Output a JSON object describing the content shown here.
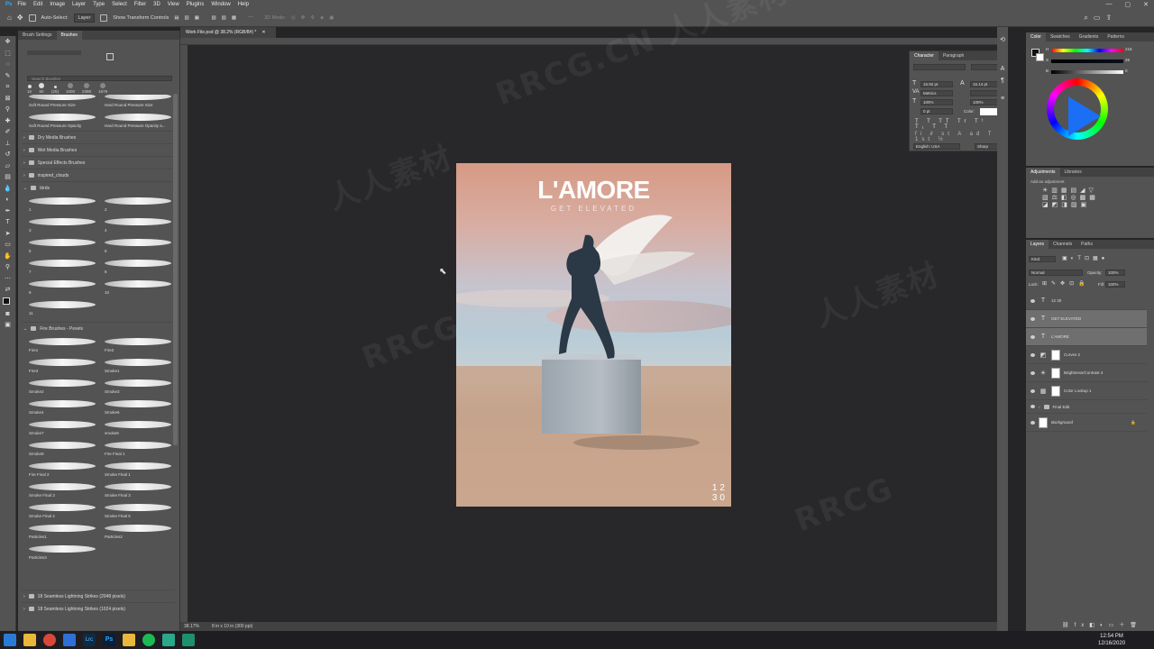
{
  "menu": {
    "items": [
      "File",
      "Edit",
      "Image",
      "Layer",
      "Type",
      "Select",
      "Filter",
      "3D",
      "View",
      "Plugins",
      "Window",
      "Help"
    ]
  },
  "options_bar": {
    "auto_select_label": "Auto-Select:",
    "auto_select_value": "Layer",
    "transform_label": "Show Transform Controls",
    "mode_label": "3D Mode:"
  },
  "brush_panel": {
    "tabs": [
      "Brush Settings",
      "Brushes"
    ],
    "search_placeholder": "Search Brushes",
    "preset_sizes": [
      "15",
      "60",
      "(25)",
      "1000",
      "2398",
      "1679"
    ],
    "top_brushes": [
      "Soft Round Pressure Size",
      "Hard Round Pressure Size",
      "Soft Round Pressure Opacity",
      "Hard Round Pressure Opacity a..."
    ],
    "folders_a": [
      "Dry Media Brushes",
      "Wet Media Brushes",
      "Special Effects Brushes",
      "inspired_clouds",
      "birds"
    ],
    "birds_brushes": [
      "1",
      "2",
      "3",
      "4",
      "5",
      "6",
      "7",
      "8",
      "9",
      "10",
      "11"
    ],
    "fire_folder": "Fire Brushes - Pexels",
    "fire_brushes": [
      "Fire1",
      "Fire2",
      "Fire3",
      "Smoke1",
      "Smoke2",
      "Smoke3",
      "Smoke4",
      "Smoke6",
      "Smoke7",
      "smoke8",
      "Smoke9",
      "Fire Final 1",
      "Fire Final 2",
      "Smoke Final 1",
      "Smoke Final 3",
      "Smoke Final 3",
      "Smoke Final 4",
      "Smoke Final 5",
      "Particles1",
      "Particles2",
      "Particles3"
    ],
    "bottom_folders": [
      "18 Seamless Lightning Strikes (2048 pixels)",
      "18 Seamless Lightning Strikes (1024 pixels)"
    ]
  },
  "document": {
    "tab_title": "Work File.psd @ 38.2% (RGB/8#) *",
    "zoom": "38.17%",
    "doc_size": "8 in x 10 in (300 ppi)"
  },
  "poster": {
    "title": "L'AMORE",
    "subtitle": "GET ELEVATED",
    "number_top": "12",
    "number_bottom": "30"
  },
  "character_panel": {
    "tabs": [
      "Character",
      "Paragraph"
    ],
    "font_size": "16.92 pt",
    "leading": "16.14 pt",
    "kerning": "Metrics",
    "vertical_scale": "100%",
    "horizontal_scale": "100%",
    "baseline": "0 pt",
    "color_label": "Color:",
    "language": "English: USA",
    "antialias": "Sharp"
  },
  "color_panel": {
    "tabs": [
      "Color",
      "Swatches",
      "Gradients",
      "Patterns"
    ],
    "h_value": "218",
    "s_value": "25",
    "b_value": "0"
  },
  "adjustments_panel": {
    "tabs": [
      "Adjustments",
      "Libraries"
    ],
    "add_label": "Add an adjustment"
  },
  "layers_panel": {
    "tabs": [
      "Layers",
      "Channels",
      "Paths"
    ],
    "kind_label": "Kind",
    "blend_mode": "Normal",
    "opacity_label": "Opacity:",
    "opacity_value": "100%",
    "lock_label": "Lock:",
    "fill_label": "Fill:",
    "fill_value": "100%",
    "layers": [
      {
        "name": "12 30",
        "type": "text",
        "selected": false
      },
      {
        "name": "GET ELEVATED",
        "type": "text",
        "selected": true
      },
      {
        "name": "L'AMORE",
        "type": "text",
        "selected": true
      },
      {
        "name": "Curves 2",
        "type": "adj",
        "selected": false
      },
      {
        "name": "Brightness/Contrast 4",
        "type": "adj",
        "selected": false
      },
      {
        "name": "Color Lookup 1",
        "type": "adj",
        "selected": false
      },
      {
        "name": "Final Edit",
        "type": "folder",
        "selected": false
      },
      {
        "name": "Background",
        "type": "bg",
        "selected": false
      }
    ]
  },
  "taskbar": {
    "time": "12:54 PM",
    "date": "12/16/2020"
  },
  "watermarks": [
    "RRCG.CN 人人素材",
    "RRCG",
    "人人素材",
    "RRCG",
    "人人素材"
  ],
  "accent_color": "#1473e6"
}
